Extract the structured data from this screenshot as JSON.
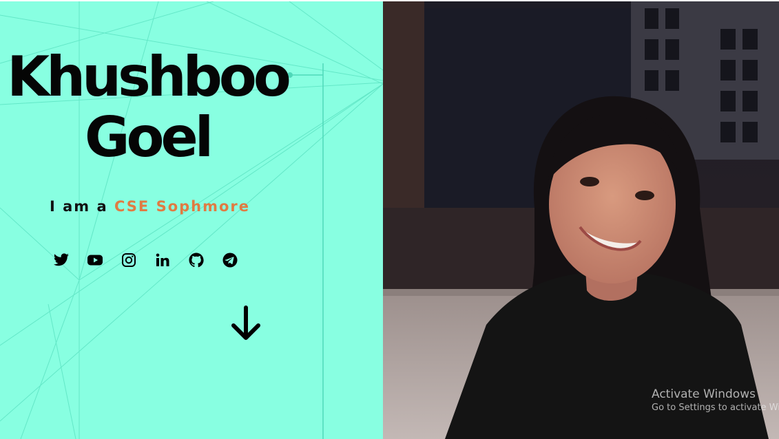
{
  "hero": {
    "name_first": "Khushboo",
    "name_last": "Goel",
    "tagline_prefix": "I am a",
    "tagline_highlight": "CSE Sophmore",
    "background_color": "#88ffe1",
    "accent_color": "#e07b42"
  },
  "social_links": [
    {
      "icon": "twitter-icon"
    },
    {
      "icon": "youtube-icon"
    },
    {
      "icon": "instagram-icon"
    },
    {
      "icon": "linkedin-icon"
    },
    {
      "icon": "github-icon"
    },
    {
      "icon": "telegram-icon"
    }
  ],
  "scroll_down": {
    "icon": "arrow-down-icon"
  },
  "watermark": {
    "title": "Activate Windows",
    "subtitle": "Go to Settings to activate Windows."
  }
}
